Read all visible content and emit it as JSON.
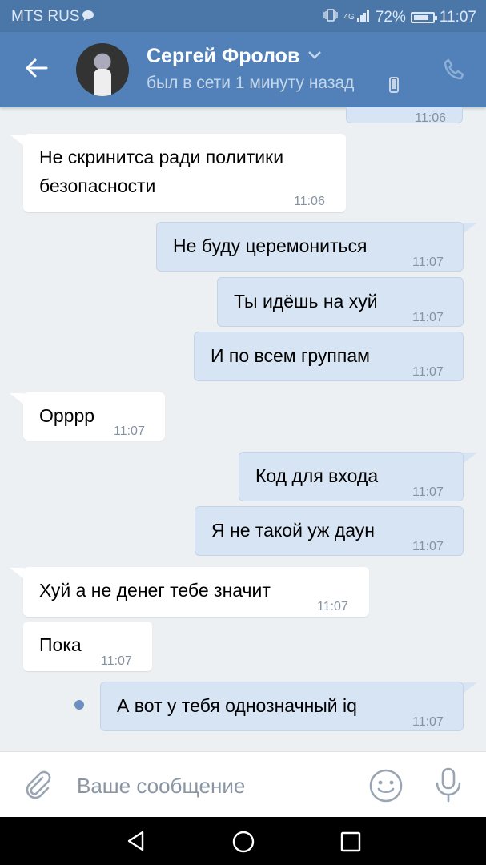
{
  "status_bar": {
    "carrier": "MTS RUS",
    "network": "4G",
    "battery": "72%",
    "battery_level": 0.72,
    "time": "11:07"
  },
  "header": {
    "contact_name": "Сергей Фролов",
    "status": "был в сети 1 минуту назад",
    "accent_color": "#5181b8"
  },
  "partial_top_time": "11:06",
  "messages": [
    {
      "dir": "in",
      "text1": "Не скринитса ради политики",
      "text2": "безопасности",
      "time": "11:06"
    },
    {
      "dir": "out",
      "text": "Не буду церемониться",
      "time": "11:07"
    },
    {
      "dir": "out",
      "text": "Ты идёшь на хуй",
      "time": "11:07"
    },
    {
      "dir": "out",
      "text": "И по всем группам",
      "time": "11:07"
    },
    {
      "dir": "in",
      "text": "Орррр",
      "time": "11:07"
    },
    {
      "dir": "out",
      "text": "Код для входа",
      "time": "11:07"
    },
    {
      "dir": "out",
      "text": "Я не такой уж даун",
      "time": "11:07"
    },
    {
      "dir": "in",
      "text": "Хуй а не денег тебе значит",
      "time": "11:07"
    },
    {
      "dir": "in",
      "text": "Пока",
      "time": "11:07"
    },
    {
      "dir": "out",
      "text": "А вот у тебя однозначный iq",
      "time": "11:07",
      "unread": true
    }
  ],
  "composer": {
    "placeholder": "Ваше сообщение"
  },
  "icons": {
    "back": "arrow-left-icon",
    "call": "phone-icon",
    "attach": "paperclip-icon",
    "emoji": "smiley-icon",
    "mic": "microphone-icon"
  }
}
